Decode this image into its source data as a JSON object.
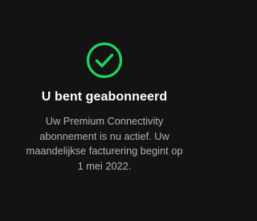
{
  "dialog": {
    "title": "U bent geabonneerd",
    "message_lines": [
      "Uw Premium Connectivity",
      "abonnement is nu actief. Uw",
      "maandelijkse facturering begint op",
      "1 mei 2022."
    ],
    "icon": "check-circle-icon"
  },
  "colors": {
    "background": "#131313",
    "accent": "#1ed760",
    "title": "#ffffff",
    "body": "#b3b3b3"
  }
}
